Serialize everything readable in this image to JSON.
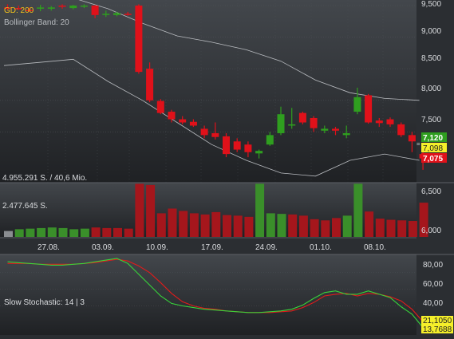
{
  "colors": {
    "background_top": "#43474c",
    "background_bottom": "#1e2023",
    "grid": "#4c5055",
    "up_candle": "#2f9e1f",
    "down_candle": "#e0111a",
    "bollinger": "#b9bcc0",
    "volume_up": "#3a8f2a",
    "volume_down": "#a5161c",
    "stoch_k": "#37d43a",
    "stoch_d": "#e11b1b",
    "axis_text": "#dadcdf",
    "label_gd": "#f2c21b"
  },
  "labels": {
    "gd": "GD: 200",
    "bollinger": "Bollinger Band: 20",
    "volume_top": "4.955.291 S. / 40,6 Mio.",
    "volume_mid": "2.477.645 S.",
    "stochastic": "Slow Stochastic: 14 | 3"
  },
  "price_axis": [
    "9,500",
    "9,000",
    "8,500",
    "8,000",
    "7,500"
  ],
  "volume_axis": [
    "6,500",
    "6,000"
  ],
  "stoch_axis": [
    "80,00",
    "60,00",
    "40,00"
  ],
  "date_labels": [
    "27.08.",
    "03.09.",
    "10.09.",
    "17.09.",
    "24.09.",
    "01.10.",
    "08.10."
  ],
  "price_tags": [
    {
      "value": "7,120",
      "bg": "#2f9e1f",
      "fg": "#ffffff"
    },
    {
      "value": "7,098",
      "bg": "#f5ef2a",
      "fg": "#222222"
    },
    {
      "value": "7,075",
      "bg": "#e0111a",
      "fg": "#ffffff"
    }
  ],
  "stoch_tags": [
    {
      "value": "21,1050",
      "bg": "#f5ef2a",
      "fg": "#222222"
    },
    {
      "value": "13,7688",
      "bg": "#f5ef2a",
      "fg": "#222222"
    }
  ],
  "chart_data": {
    "type": "candlestick",
    "price_ylim": [
      7.0,
      9.55
    ],
    "candles": [
      {
        "o": 9.47,
        "h": 9.52,
        "l": 9.43,
        "c": 9.45
      },
      {
        "o": 9.46,
        "h": 9.5,
        "l": 9.43,
        "c": 9.44
      },
      {
        "o": 9.43,
        "h": 9.47,
        "l": 9.4,
        "c": 9.42
      },
      {
        "o": 9.45,
        "h": 9.51,
        "l": 9.41,
        "c": 9.47
      },
      {
        "o": 9.45,
        "h": 9.49,
        "l": 9.42,
        "c": 9.47
      },
      {
        "o": 9.5,
        "h": 9.52,
        "l": 9.45,
        "c": 9.48
      },
      {
        "o": 9.46,
        "h": 9.51,
        "l": 9.44,
        "c": 9.5
      },
      {
        "o": 9.49,
        "h": 9.52,
        "l": 9.46,
        "c": 9.5
      },
      {
        "o": 9.5,
        "h": 9.51,
        "l": 9.3,
        "c": 9.35
      },
      {
        "o": 9.36,
        "h": 9.42,
        "l": 9.32,
        "c": 9.37
      },
      {
        "o": 9.35,
        "h": 9.4,
        "l": 9.33,
        "c": 9.38
      },
      {
        "o": 9.37,
        "h": 9.4,
        "l": 9.34,
        "c": 9.36
      },
      {
        "o": 9.5,
        "h": 9.52,
        "l": 8.42,
        "c": 8.45
      },
      {
        "o": 8.5,
        "h": 8.6,
        "l": 7.97,
        "c": 8.0
      },
      {
        "o": 7.99,
        "h": 8.02,
        "l": 7.78,
        "c": 7.8
      },
      {
        "o": 7.82,
        "h": 7.85,
        "l": 7.65,
        "c": 7.7
      },
      {
        "o": 7.7,
        "h": 7.75,
        "l": 7.62,
        "c": 7.65
      },
      {
        "o": 7.66,
        "h": 7.7,
        "l": 7.58,
        "c": 7.6
      },
      {
        "o": 7.55,
        "h": 7.6,
        "l": 7.4,
        "c": 7.45
      },
      {
        "o": 7.48,
        "h": 7.65,
        "l": 7.38,
        "c": 7.42
      },
      {
        "o": 7.43,
        "h": 7.48,
        "l": 7.1,
        "c": 7.15
      },
      {
        "o": 7.35,
        "h": 7.4,
        "l": 7.18,
        "c": 7.22
      },
      {
        "o": 7.3,
        "h": 7.35,
        "l": 7.1,
        "c": 7.18
      },
      {
        "o": 7.16,
        "h": 7.22,
        "l": 7.08,
        "c": 7.2
      },
      {
        "o": 7.3,
        "h": 7.5,
        "l": 7.28,
        "c": 7.45
      },
      {
        "o": 7.48,
        "h": 7.9,
        "l": 7.45,
        "c": 7.78
      },
      {
        "o": 7.6,
        "h": 7.88,
        "l": 7.55,
        "c": 7.62
      },
      {
        "o": 7.8,
        "h": 7.82,
        "l": 7.62,
        "c": 7.65
      },
      {
        "o": 7.72,
        "h": 7.75,
        "l": 7.5,
        "c": 7.56
      },
      {
        "o": 7.52,
        "h": 7.6,
        "l": 7.48,
        "c": 7.55
      },
      {
        "o": 7.55,
        "h": 7.58,
        "l": 7.45,
        "c": 7.52
      },
      {
        "o": 7.45,
        "h": 7.6,
        "l": 7.4,
        "c": 7.48
      },
      {
        "o": 7.82,
        "h": 8.2,
        "l": 7.78,
        "c": 8.05
      },
      {
        "o": 8.08,
        "h": 8.1,
        "l": 7.63,
        "c": 7.65
      },
      {
        "o": 7.68,
        "h": 7.72,
        "l": 7.58,
        "c": 7.64
      },
      {
        "o": 7.7,
        "h": 7.73,
        "l": 7.58,
        "c": 7.62
      },
      {
        "o": 7.62,
        "h": 7.65,
        "l": 7.42,
        "c": 7.45
      },
      {
        "o": 7.45,
        "h": 7.5,
        "l": 7.18,
        "c": 7.35
      },
      {
        "o": 7.15,
        "h": 7.2,
        "l": 6.9,
        "c": 7.08
      }
    ],
    "bollinger_upper": [
      9.7,
      9.7,
      9.6,
      9.5,
      9.25,
      9.05,
      8.95,
      8.85,
      8.65,
      8.35,
      8.15,
      8.05,
      8.0
    ],
    "bollinger_lower": [
      8.55,
      8.6,
      8.65,
      8.3,
      8.0,
      7.65,
      7.3,
      7.05,
      6.85,
      6.8,
      7.05,
      7.15,
      7.05
    ],
    "bollinger_upper_x": [
      0,
      2,
      4,
      6,
      8,
      10,
      12,
      14,
      16,
      18,
      20,
      22,
      24
    ],
    "volume": [
      1.0,
      1.3,
      1.4,
      1.5,
      1.6,
      1.5,
      1.3,
      1.4,
      1.6,
      1.5,
      1.5,
      1.4,
      9.0,
      8.8,
      4.0,
      4.8,
      4.4,
      4.0,
      3.8,
      4.2,
      3.7,
      3.6,
      3.4,
      9.0,
      4.0,
      3.9,
      3.8,
      3.6,
      3.0,
      2.8,
      3.2,
      3.6,
      9.0,
      4.3,
      3.1,
      2.9,
      2.8,
      2.7,
      5.8
    ],
    "volume_up": [
      0,
      1,
      1,
      1,
      1,
      1,
      1,
      1,
      0,
      0,
      0,
      0,
      0,
      0,
      0,
      0,
      0,
      0,
      0,
      0,
      0,
      0,
      0,
      1,
      1,
      1,
      0,
      0,
      0,
      0,
      0,
      1,
      1,
      0,
      0,
      0,
      0,
      0,
      0
    ],
    "stoch_k": [
      93,
      92,
      91,
      90,
      89,
      89,
      90,
      91,
      93,
      95,
      97,
      91,
      78,
      65,
      52,
      43,
      40,
      38,
      36,
      35,
      34,
      33,
      32,
      32,
      33,
      34,
      36,
      41,
      49,
      56,
      58,
      54,
      54,
      58,
      54,
      50,
      39,
      30,
      14
    ],
    "stoch_d": [
      91,
      91,
      91,
      90,
      90,
      90,
      90,
      91,
      92,
      94,
      96,
      94,
      88,
      80,
      68,
      55,
      45,
      40,
      37,
      36,
      34,
      33,
      32,
      32,
      32,
      33,
      34,
      38,
      44,
      52,
      54,
      55,
      52,
      55,
      54,
      51,
      46,
      36,
      21
    ]
  }
}
